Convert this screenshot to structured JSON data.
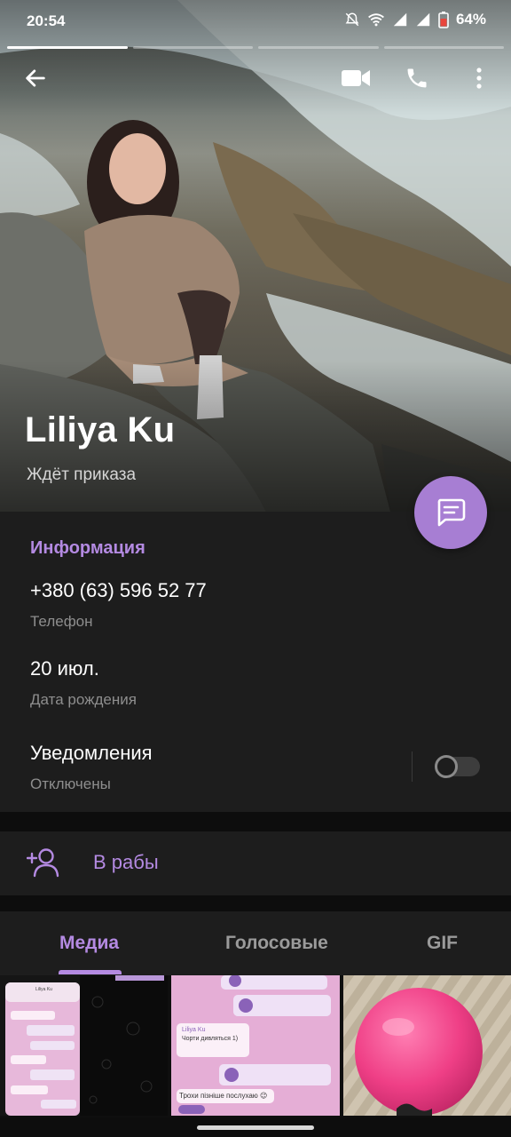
{
  "status_bar": {
    "time": "20:54",
    "battery_percent": "64%",
    "icons": [
      "mute-icon",
      "wifi-icon",
      "signal-icon",
      "signal-icon",
      "battery-icon"
    ]
  },
  "story_progress": {
    "segments": 4,
    "active_segment": 1
  },
  "header": {
    "back_icon": "arrow-left-icon",
    "video_call_icon": "video-camera-icon",
    "call_icon": "phone-icon",
    "menu_icon": "more-vertical-icon"
  },
  "profile": {
    "name": "Liliya Ku",
    "status": "Ждёт приказа"
  },
  "fab": {
    "icon": "message-icon"
  },
  "info": {
    "title": "Информация",
    "phone_value": "+380 (63) 596 52 77",
    "phone_label": "Телефон",
    "birthday_value": "20 июл.",
    "birthday_label": "Дата рождения",
    "notifications_value": "Уведомления",
    "notifications_label": "Отключены",
    "notifications_enabled": false
  },
  "action": {
    "icon": "add-contact-icon",
    "label": "В рабы"
  },
  "tabs": [
    {
      "label": "Медиа",
      "active": true
    },
    {
      "label": "Голосовые",
      "active": false
    },
    {
      "label": "GIF",
      "active": false
    }
  ],
  "media_thumbs": {
    "thumb1_name": "Liliya Ku",
    "thumb2_name": "Liliya Ku",
    "thumb2_text": "Чорти дивляться 1)",
    "thumb2_caption": "Трохи пізніше послухаю 😉"
  },
  "colors": {
    "accent": "#b48ae2",
    "fab": "#a77ed3",
    "background": "#1d1d1d"
  }
}
